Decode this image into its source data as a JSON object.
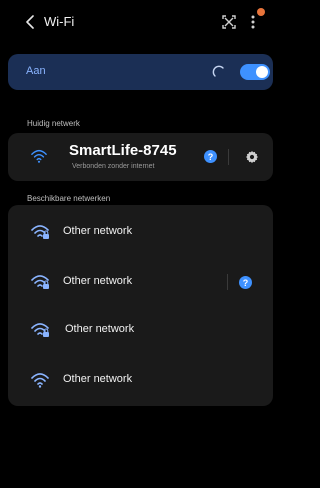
{
  "header": {
    "title": "Wi-Fi"
  },
  "toggle": {
    "label": "Aan",
    "state": "on"
  },
  "current_section": {
    "label": "Huidig netwerk"
  },
  "current_network": {
    "name": "SmartLife-8745",
    "status": "Verbonden zonder internet",
    "help_label": "?"
  },
  "available_section": {
    "label": "Beschikbare netwerken"
  },
  "available_networks": [
    {
      "name": "Other network",
      "secured": true,
      "has_help": false
    },
    {
      "name": "Other network",
      "secured": true,
      "has_help": true,
      "help_label": "?"
    },
    {
      "name": "Other network",
      "secured": true,
      "has_help": false
    },
    {
      "name": "Other network",
      "secured": false,
      "has_help": false
    }
  ],
  "colors": {
    "accent": "#3e91ff",
    "toggle_card": "#1b2f55",
    "card": "#1a1a1a",
    "notification": "#e8743b"
  },
  "icons": {
    "back": "chevron-left-icon",
    "scan": "scan-icon",
    "more": "more-vert-icon",
    "wifi": "wifi-icon",
    "wifi_lock": "wifi-lock-icon",
    "settings": "gear-icon",
    "help": "help-icon"
  }
}
